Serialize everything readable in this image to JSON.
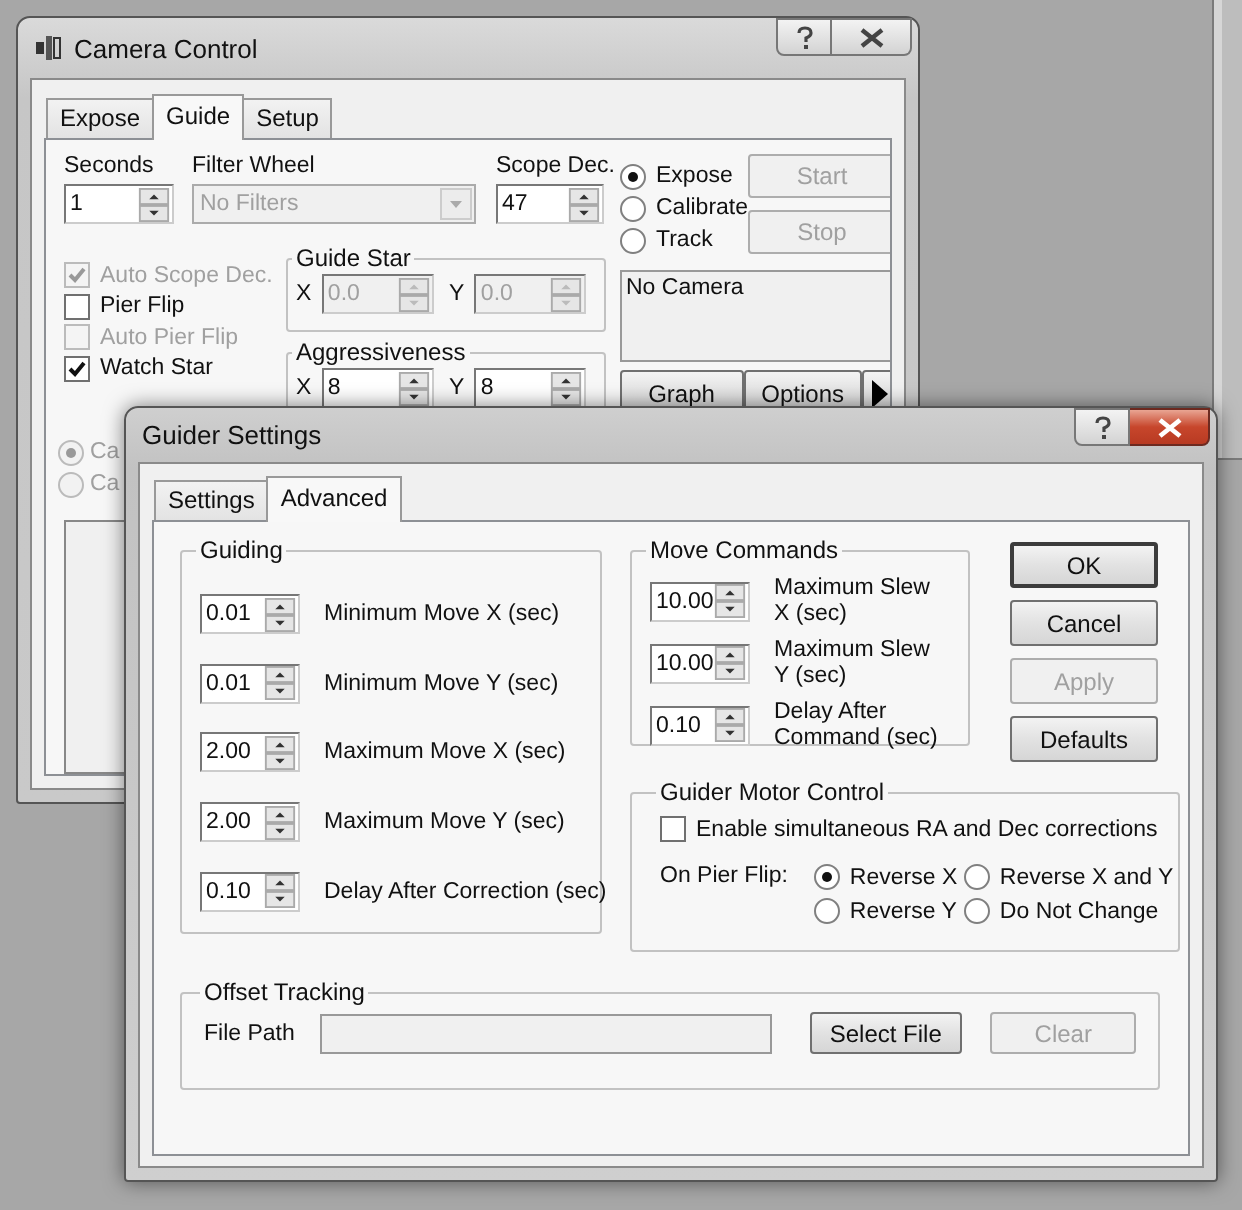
{
  "camera": {
    "title": "Camera Control",
    "tabs": [
      {
        "label": "Expose",
        "selected": false
      },
      {
        "label": "Guide",
        "selected": true
      },
      {
        "label": "Setup",
        "selected": false
      }
    ],
    "seconds": {
      "label": "Seconds",
      "value": "1"
    },
    "filter_wheel": {
      "label": "Filter Wheel",
      "value": "No Filters",
      "disabled": true
    },
    "scope_dec": {
      "label": "Scope Dec.",
      "value": "47"
    },
    "mode_radios": [
      {
        "label": "Expose",
        "selected": true
      },
      {
        "label": "Calibrate",
        "selected": false
      },
      {
        "label": "Track",
        "selected": false
      }
    ],
    "action_buttons": [
      {
        "label": "Start",
        "disabled": true
      },
      {
        "label": "Stop",
        "disabled": true
      }
    ],
    "checkboxes": [
      {
        "label": "Auto Scope Dec.",
        "checked": true,
        "disabled": true
      },
      {
        "label": "Pier Flip",
        "checked": false,
        "disabled": false
      },
      {
        "label": "Auto Pier Flip",
        "checked": false,
        "disabled": true
      },
      {
        "label": "Watch Star",
        "checked": true,
        "disabled": false
      }
    ],
    "guide_star": {
      "title": "Guide Star",
      "fields": [
        {
          "label": "X",
          "value": "0.0",
          "disabled": true
        },
        {
          "label": "Y",
          "value": "0.0",
          "disabled": true
        }
      ]
    },
    "aggressiveness": {
      "title": "Aggressiveness",
      "fields": [
        {
          "label": "X",
          "value": "8",
          "disabled": false
        },
        {
          "label": "Y",
          "value": "8",
          "disabled": false
        }
      ]
    },
    "status": "No Camera",
    "bottom_buttons": [
      {
        "label": "Graph"
      },
      {
        "label": "Options"
      }
    ],
    "lower_radios": [
      {
        "label": "Ca",
        "selected": true,
        "disabled": true
      },
      {
        "label": "Ca",
        "selected": false,
        "disabled": true
      }
    ]
  },
  "guider": {
    "title": "Guider Settings",
    "tabs": [
      {
        "label": "Settings",
        "selected": false
      },
      {
        "label": "Advanced",
        "selected": true
      }
    ],
    "guiding": {
      "title": "Guiding",
      "rows": [
        {
          "value": "0.01",
          "label": "Minimum Move X (sec)"
        },
        {
          "value": "0.01",
          "label": "Minimum Move Y (sec)"
        },
        {
          "value": "2.00",
          "label": "Maximum Move X (sec)"
        },
        {
          "value": "2.00",
          "label": "Maximum Move Y (sec)"
        },
        {
          "value": "0.10",
          "label": "Delay After Correction (sec)"
        }
      ]
    },
    "move_commands": {
      "title": "Move Commands",
      "rows": [
        {
          "value": "10.00",
          "label": "Maximum Slew X (sec)"
        },
        {
          "value": "10.00",
          "label": "Maximum Slew Y (sec)"
        },
        {
          "value": "0.10",
          "label": "Delay After Command (sec)"
        }
      ]
    },
    "buttons": [
      {
        "label": "OK",
        "default": true,
        "disabled": false
      },
      {
        "label": "Cancel",
        "default": false,
        "disabled": false
      },
      {
        "label": "Apply",
        "default": false,
        "disabled": true
      },
      {
        "label": "Defaults",
        "default": false,
        "disabled": false
      }
    ],
    "motor_control": {
      "title": "Guider Motor Control",
      "simultaneous": {
        "label": "Enable simultaneous RA and Dec corrections",
        "checked": false
      },
      "pier_flip_label": "On Pier Flip:",
      "pier_flip_options": [
        {
          "label": "Reverse X",
          "selected": true
        },
        {
          "label": "Reverse X and Y",
          "selected": false
        },
        {
          "label": "Reverse Y",
          "selected": false
        },
        {
          "label": "Do Not Change",
          "selected": false
        }
      ]
    },
    "offset_tracking": {
      "title": "Offset Tracking",
      "file_path": {
        "label": "File Path",
        "disabled": true
      },
      "buttons": [
        {
          "label": "Select File",
          "disabled": false
        },
        {
          "label": "Clear",
          "disabled": true
        }
      ]
    }
  }
}
